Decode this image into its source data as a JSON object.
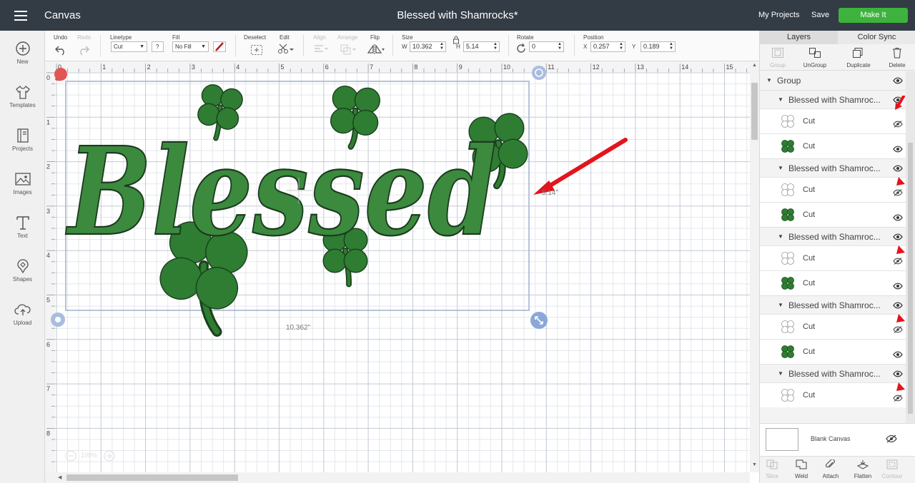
{
  "header": {
    "app_name": "Canvas",
    "title": "Blessed with Shamrocks*",
    "my_projects": "My Projects",
    "save": "Save",
    "make_it": "Make It"
  },
  "sidebar": {
    "items": [
      {
        "label": "New",
        "icon": "plus-circle-icon"
      },
      {
        "label": "Templates",
        "icon": "shirt-icon"
      },
      {
        "label": "Projects",
        "icon": "book-icon"
      },
      {
        "label": "Images",
        "icon": "image-icon"
      },
      {
        "label": "Text",
        "icon": "text-icon"
      },
      {
        "label": "Shapes",
        "icon": "shapes-icon"
      },
      {
        "label": "Upload",
        "icon": "upload-cloud-icon"
      }
    ]
  },
  "toolbar": {
    "undo": "Undo",
    "redo": "Redo",
    "linetype_label": "Linetype",
    "linetype_value": "Cut",
    "fill_label": "Fill",
    "fill_value": "No Fill",
    "help": "?",
    "deselect": "Deselect",
    "edit": "Edit",
    "align": "Align",
    "arrange": "Arrange",
    "flip": "Flip",
    "size_label": "Size",
    "w_label": "W",
    "w_value": "10.362",
    "h_label": "H",
    "h_value": "5.14",
    "rotate_label": "Rotate",
    "rotate_value": "0",
    "position_label": "Position",
    "x_label": "X",
    "x_value": "0.257",
    "y_label": "Y",
    "y_value": "0.189"
  },
  "canvas": {
    "ruler_top": [
      "0",
      "1",
      "2",
      "3",
      "4",
      "5",
      "6",
      "7",
      "8",
      "9",
      "10",
      "11",
      "12",
      "13",
      "14",
      "15"
    ],
    "ruler_left": [
      "0",
      "1",
      "2",
      "3",
      "4",
      "5",
      "6",
      "7",
      "8",
      "9"
    ],
    "width_label": "10.362\"",
    "height_label": "5.14\"",
    "zoom": "100%",
    "design_text": "Blessed",
    "accent_green": "#2e7d32",
    "arrow_color": "#e3141c"
  },
  "panel": {
    "tab_layers": "Layers",
    "tab_color_sync": "Color Sync",
    "tools": {
      "group": "Group",
      "ungroup": "UnGroup",
      "duplicate": "Duplicate",
      "delete": "Delete"
    },
    "group_label": "Group",
    "subgroups": [
      {
        "name": "Blessed with Shamroc...",
        "layers": [
          "Cut",
          "Cut"
        ]
      },
      {
        "name": "Blessed with Shamroc...",
        "layers": [
          "Cut",
          "Cut"
        ]
      },
      {
        "name": "Blessed with Shamroc...",
        "layers": [
          "Cut",
          "Cut"
        ]
      },
      {
        "name": "Blessed with Shamroc...",
        "layers": [
          "Cut",
          "Cut"
        ]
      },
      {
        "name": "Blessed with Shamroc...",
        "layers": [
          "Cut"
        ]
      }
    ],
    "blank_canvas": "Blank Canvas",
    "bottom": {
      "slice": "Slice",
      "weld": "Weld",
      "attach": "Attach",
      "flatten": "Flatten",
      "contour": "Contour"
    }
  }
}
